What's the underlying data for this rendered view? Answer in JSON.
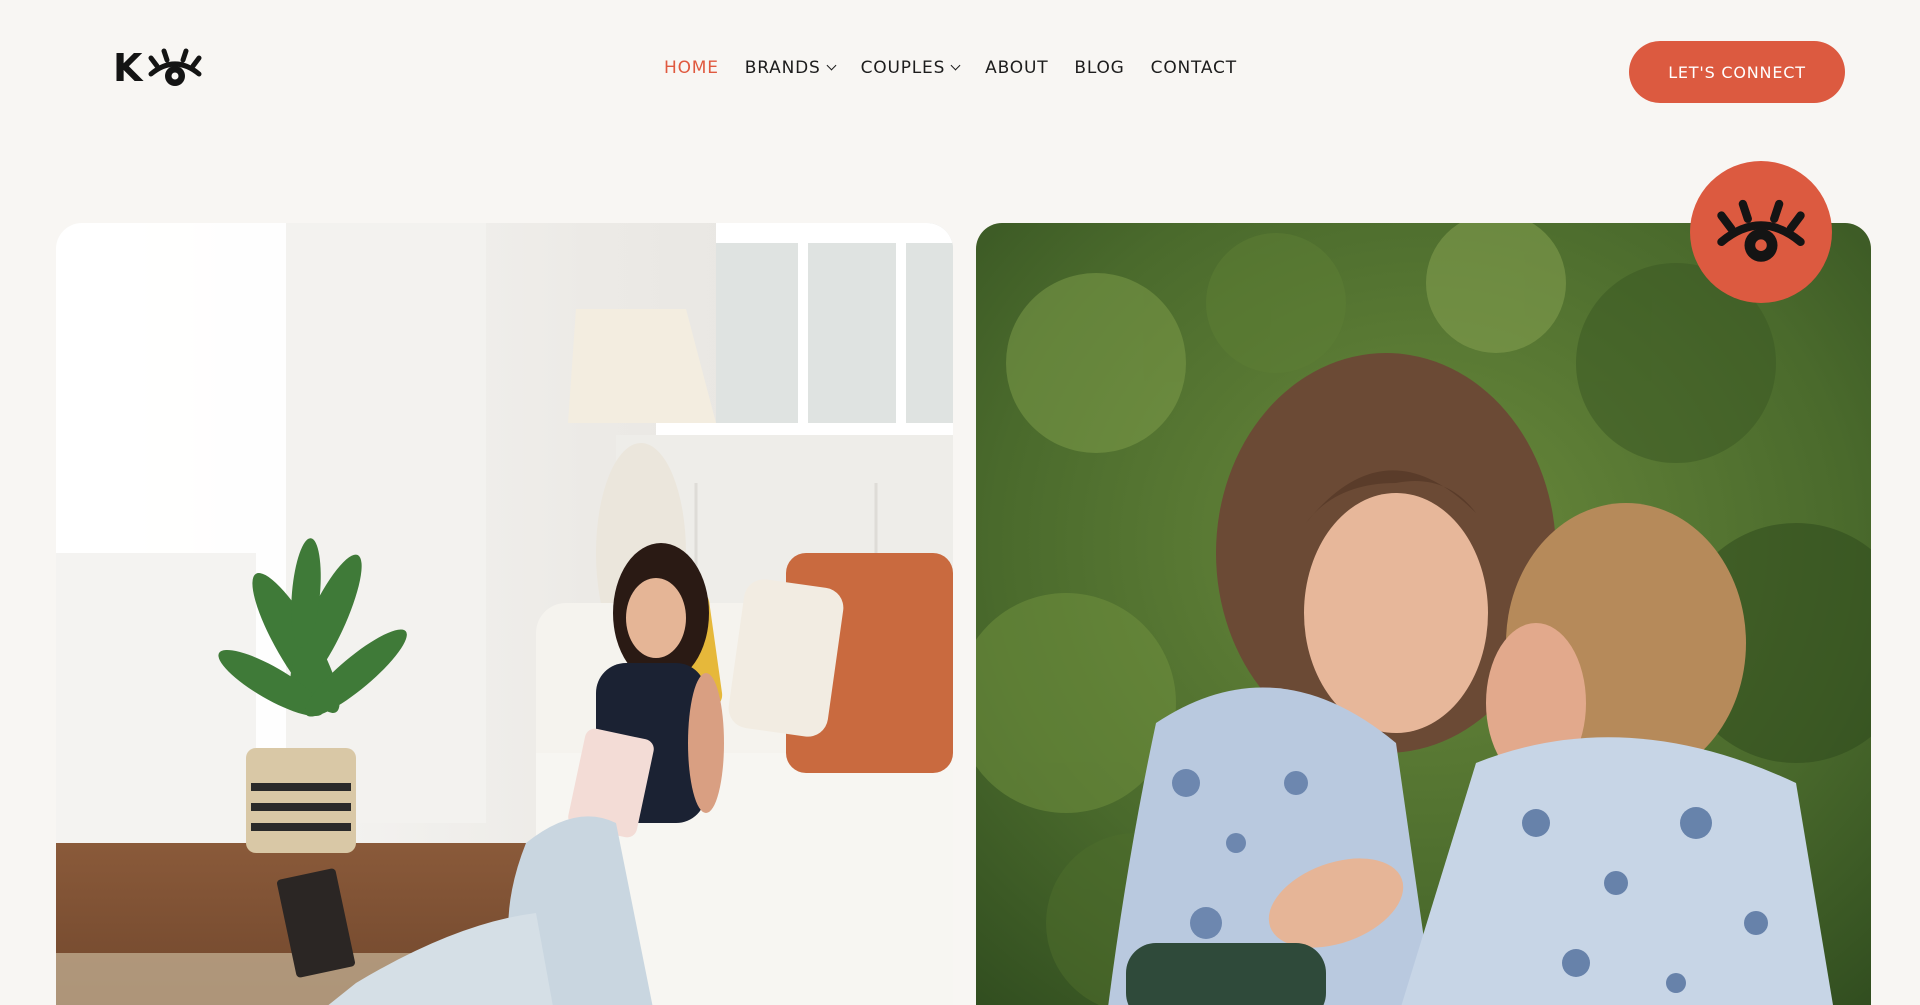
{
  "header": {
    "logo": {
      "letter": "K",
      "icon": "eye-lash-icon"
    },
    "nav": [
      {
        "label": "HOME",
        "active": true,
        "dropdown": false
      },
      {
        "label": "BRANDS",
        "active": false,
        "dropdown": true
      },
      {
        "label": "COUPLES",
        "active": false,
        "dropdown": true
      },
      {
        "label": "ABOUT",
        "active": false,
        "dropdown": false
      },
      {
        "label": "BLOG",
        "active": false,
        "dropdown": false
      },
      {
        "label": "CONTACT",
        "active": false,
        "dropdown": false
      }
    ],
    "cta_label": "LET'S CONNECT"
  },
  "gallery": {
    "left_photo": {
      "icon": "woman-with-tablet-photo"
    },
    "right_photo": {
      "icon": "couple-embracing-photo"
    },
    "badge": {
      "icon": "eye-lash-icon"
    }
  },
  "colors": {
    "accent": "#dc5a40",
    "background": "#f8f6f3",
    "text": "#1d1d1d"
  }
}
